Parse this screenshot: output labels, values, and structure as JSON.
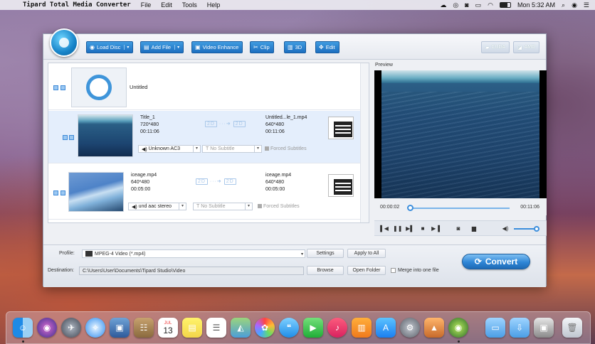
{
  "menubar": {
    "app_name": "Tipard Total Media Converter",
    "menus": [
      "File",
      "Edit",
      "Tools",
      "Help"
    ],
    "clock": "Mon 5:32 AM"
  },
  "toolbar": {
    "load_disc": "Load Disc",
    "add_file": "Add File",
    "video_enhance": "Video Enhance",
    "clip": "Clip",
    "three_d": "3D",
    "edit": "Edit",
    "cuda": "CUDA",
    "amd": "AMD"
  },
  "files": [
    {
      "title": "Untitled"
    },
    {
      "name": "Title_1",
      "resolution": "720*480",
      "duration": "00:11:06",
      "out_name": "Untitled...le_1.mp4",
      "out_resolution": "640*480",
      "out_duration": "00:11:06",
      "audio": "Unknown AC3",
      "subtitle": "No Subtitle",
      "forced": "Forced Subtitles"
    },
    {
      "name": "iceage.mp4",
      "resolution": "640*480",
      "duration": "00:05:00",
      "out_name": "iceage.mp4",
      "out_resolution": "640*480",
      "out_duration": "00:05:00",
      "audio": "und aac stereo",
      "subtitle": "No Subtitle",
      "forced": "Forced Subtitles"
    }
  ],
  "arrow_label": "2D",
  "preview": {
    "label": "Preview",
    "current_time": "00:00:02",
    "total_time": "00:11:06",
    "progress": 0.003,
    "volume": 0.9
  },
  "bottom": {
    "profile_label": "Profile:",
    "profile_value": "MPEG-4 Video (*.mp4)",
    "settings": "Settings",
    "apply_to_all": "Apply to All",
    "destination_label": "Destination:",
    "destination_value": "C:\\Users\\User\\Documents\\Tipard Studio\\Video",
    "browse": "Browse",
    "open_folder": "Open Folder",
    "merge_label": "Merge into one file",
    "convert": "Convert"
  },
  "dock": {
    "calendar_day": "13",
    "calendar_month": "JUL"
  }
}
